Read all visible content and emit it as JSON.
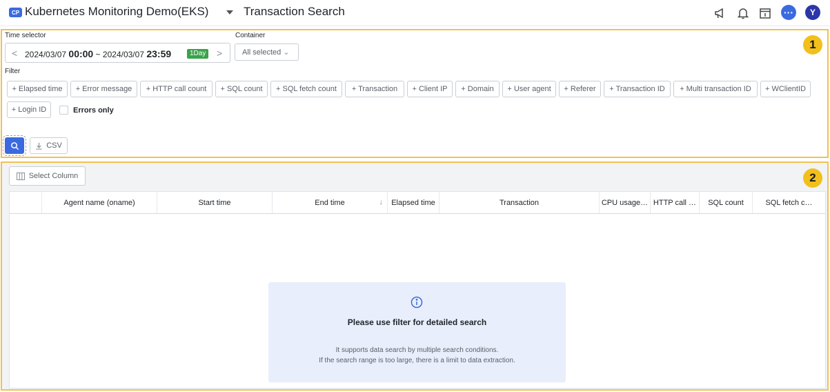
{
  "header": {
    "project_badge": "CP",
    "project_name": "Kubernetes Monitoring Demo(EKS)",
    "page_title": "Transaction Search",
    "icons": [
      "megaphone-icon",
      "bell-icon",
      "calendar-icon",
      "chat-icon",
      "avatar"
    ],
    "avatar_initial": "Y"
  },
  "callouts": [
    "1",
    "2"
  ],
  "filters": {
    "time_selector_label": "Time selector",
    "time_start_date": "2024/03/07",
    "time_start_clock": "00:00",
    "time_separator": "~",
    "time_end_date": "2024/03/07",
    "time_end_clock": "23:59",
    "range_badge": "1Day",
    "container_label": "Container",
    "container_value": "All selected",
    "filter_label": "Filter",
    "chips": [
      "+ Elapsed time",
      "+ Error message",
      "+ HTTP call count",
      "+ SQL count",
      "+ SQL fetch count",
      "+ Transaction",
      "+ Client IP",
      "+ Domain",
      "+ User agent",
      "+ Referer",
      "+ Transaction ID",
      "+ Multi transaction ID",
      "+ WClientID",
      "+ Login ID"
    ],
    "errors_only_label": "Errors only",
    "csv_label": "CSV"
  },
  "table": {
    "select_column_label": "Select Column",
    "columns": [
      "",
      "Agent name (oname)",
      "Start time",
      "End time",
      "Elapsed time",
      "Transaction",
      "CPU usage…",
      "HTTP call …",
      "SQL count",
      "SQL fetch c…"
    ],
    "sorted_column": "End time",
    "empty_state": {
      "title": "Please use filter for detailed search",
      "line1": "It supports data search by multiple search conditions.",
      "line2": "If the search range is too large, there is a limit to data extraction."
    }
  },
  "colors": {
    "accent": "#3b6ae0",
    "callout_border": "#f2c14e",
    "badge_green": "#3aa34a"
  }
}
